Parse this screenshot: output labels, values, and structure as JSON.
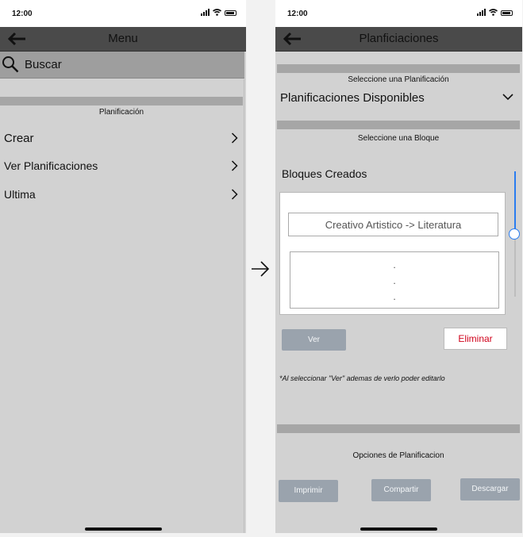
{
  "left": {
    "status": {
      "time": "12:00"
    },
    "header": {
      "title": "Menu"
    },
    "search": {
      "label": "Buscar"
    },
    "section": {
      "label": "Planificación"
    },
    "menu": [
      {
        "label": "Crear"
      },
      {
        "label": "Ver Planificaciones"
      },
      {
        "label": "Ultima"
      }
    ]
  },
  "right": {
    "status": {
      "time": "12:00"
    },
    "header": {
      "title": "Planficiaciones"
    },
    "select_plan": {
      "label": "Seleccione una Planificación",
      "dropdown_value": "Planificaciones Disponibles"
    },
    "select_block": {
      "label": "Seleccione una Bloque",
      "list_title": "Bloques Creados",
      "items": [
        "Creativo Artistico -> Literatura"
      ],
      "more_dots": ".\n.\n."
    },
    "scroll": {
      "position": 0.5
    },
    "actions": {
      "view": "Ver",
      "delete": "Eliminar"
    },
    "note": "*Al seleccionar \"Ver\" ademas de verlo poder editarlo",
    "options": {
      "label": "Opciones de Planificacion",
      "print": "Imprimir",
      "share": "Compartir",
      "download": "Descargar"
    }
  },
  "colors": {
    "header_bg": "#4a4a4a",
    "panel_bg": "#d2d2d2",
    "scroll_accent": "#2a7df0",
    "delete_text": "#d0021b",
    "button_gray": "#9aa3ad"
  },
  "icons": [
    "back-arrow-icon",
    "search-icon",
    "chevron-right-icon",
    "chevron-down-icon",
    "arrow-right-icon",
    "signal-icon",
    "wifi-icon",
    "battery-icon"
  ]
}
